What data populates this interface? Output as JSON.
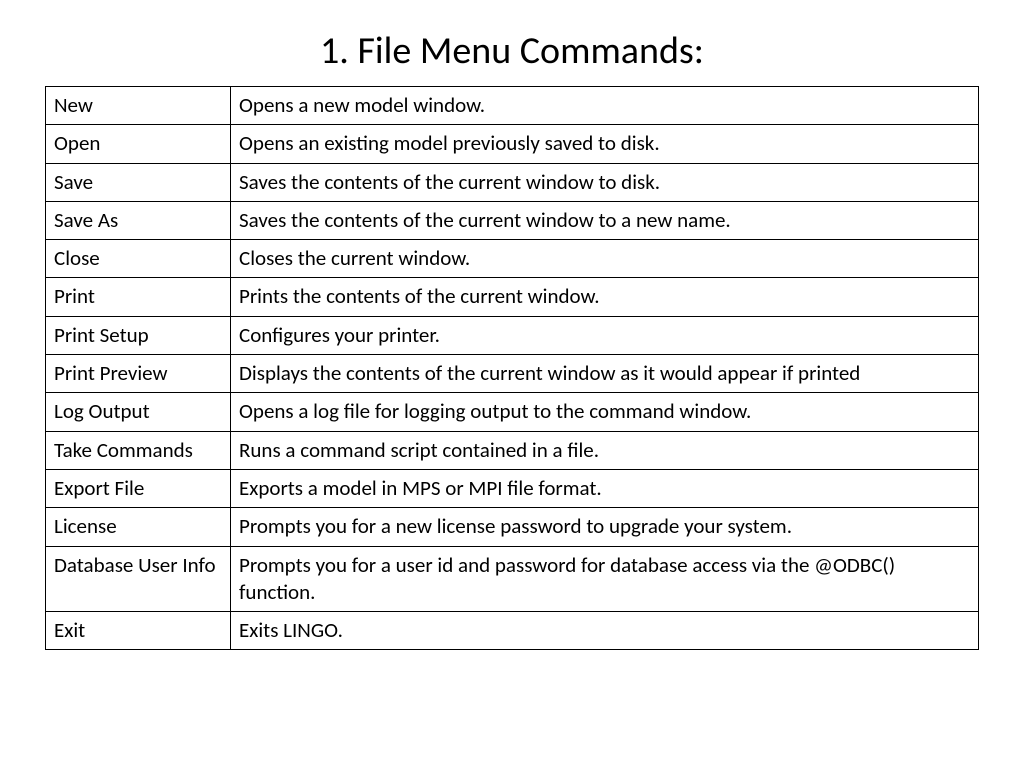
{
  "title": "1. File Menu Commands:",
  "rows": [
    {
      "command": "New",
      "description": "Opens a new model window."
    },
    {
      "command": "Open",
      "description": "Opens an existing model previously saved to disk."
    },
    {
      "command": "Save",
      "description": "Saves the contents of the current window to disk."
    },
    {
      "command": "Save As",
      "description": "Saves the contents of the current window to a new name."
    },
    {
      "command": "Close",
      "description": "Closes the current window."
    },
    {
      "command": "Print",
      "description": "Prints the contents of the current window."
    },
    {
      "command": "Print Setup",
      "description": "Configures your printer."
    },
    {
      "command": "Print Preview",
      "description": "Displays the contents of the current window as it would appear if printed"
    },
    {
      "command": "Log Output",
      "description": "Opens a log file for logging output to the command window."
    },
    {
      "command": "Take Commands",
      "description": "Runs a command script contained in a file."
    },
    {
      "command": "Export File",
      "description": "Exports a model in MPS or MPI file format."
    },
    {
      "command": "License",
      "description": "Prompts you for a new license password to upgrade your system."
    },
    {
      "command": "Database User Info",
      "description": "Prompts you for a user id and password for database access via the @ODBC() function."
    },
    {
      "command": "Exit",
      "description": "Exits LINGO."
    }
  ]
}
